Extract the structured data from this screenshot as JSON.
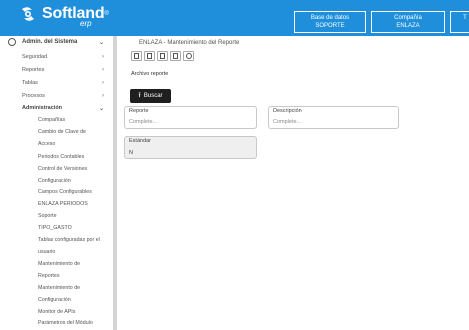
{
  "brand": {
    "name": "Softland",
    "tm": "®",
    "sub": "erp",
    "color": "#1f8fdc"
  },
  "header": {
    "buttons": [
      {
        "line1": "Base de datos",
        "line2": "SOPORTE"
      },
      {
        "line1": "Compañía",
        "line2": "ENLAZA"
      },
      {
        "line1": "T",
        "line2": ""
      }
    ]
  },
  "sidebar": {
    "section": "Admin. del Sistema",
    "items": [
      {
        "label": "Seguridad"
      },
      {
        "label": "Reportes"
      },
      {
        "label": "Tablas"
      },
      {
        "label": "Procesos"
      },
      {
        "label": "Administración"
      }
    ],
    "subitems": [
      "Compañías",
      "Cambio de Clave de",
      "Acceso",
      "Periodos Contables",
      "Control de Versiones",
      "Configuración",
      "Campos Configurables",
      "ENLAZA PERIODOS",
      "Soporte",
      "TIPO_GASTO",
      "Tablas configuradas por el",
      "usuario",
      "Mantenimiento de",
      "Reportes",
      "Mantenimiento de",
      "Configuración",
      "Monitor de APIs",
      "Parámetros del Módulo"
    ]
  },
  "main": {
    "breadcrumb": "ENLAZA - Mantenimiento del Reporte",
    "archivo_label": "Archivo reporte",
    "buscar_label": "Buscar",
    "fields": {
      "reporte": {
        "label": "Reporte",
        "placeholder": "Complete..."
      },
      "descripcion": {
        "label": "Descripción",
        "placeholder": "Complete..."
      },
      "estandar": {
        "label": "Estándar",
        "value": "N"
      }
    }
  }
}
